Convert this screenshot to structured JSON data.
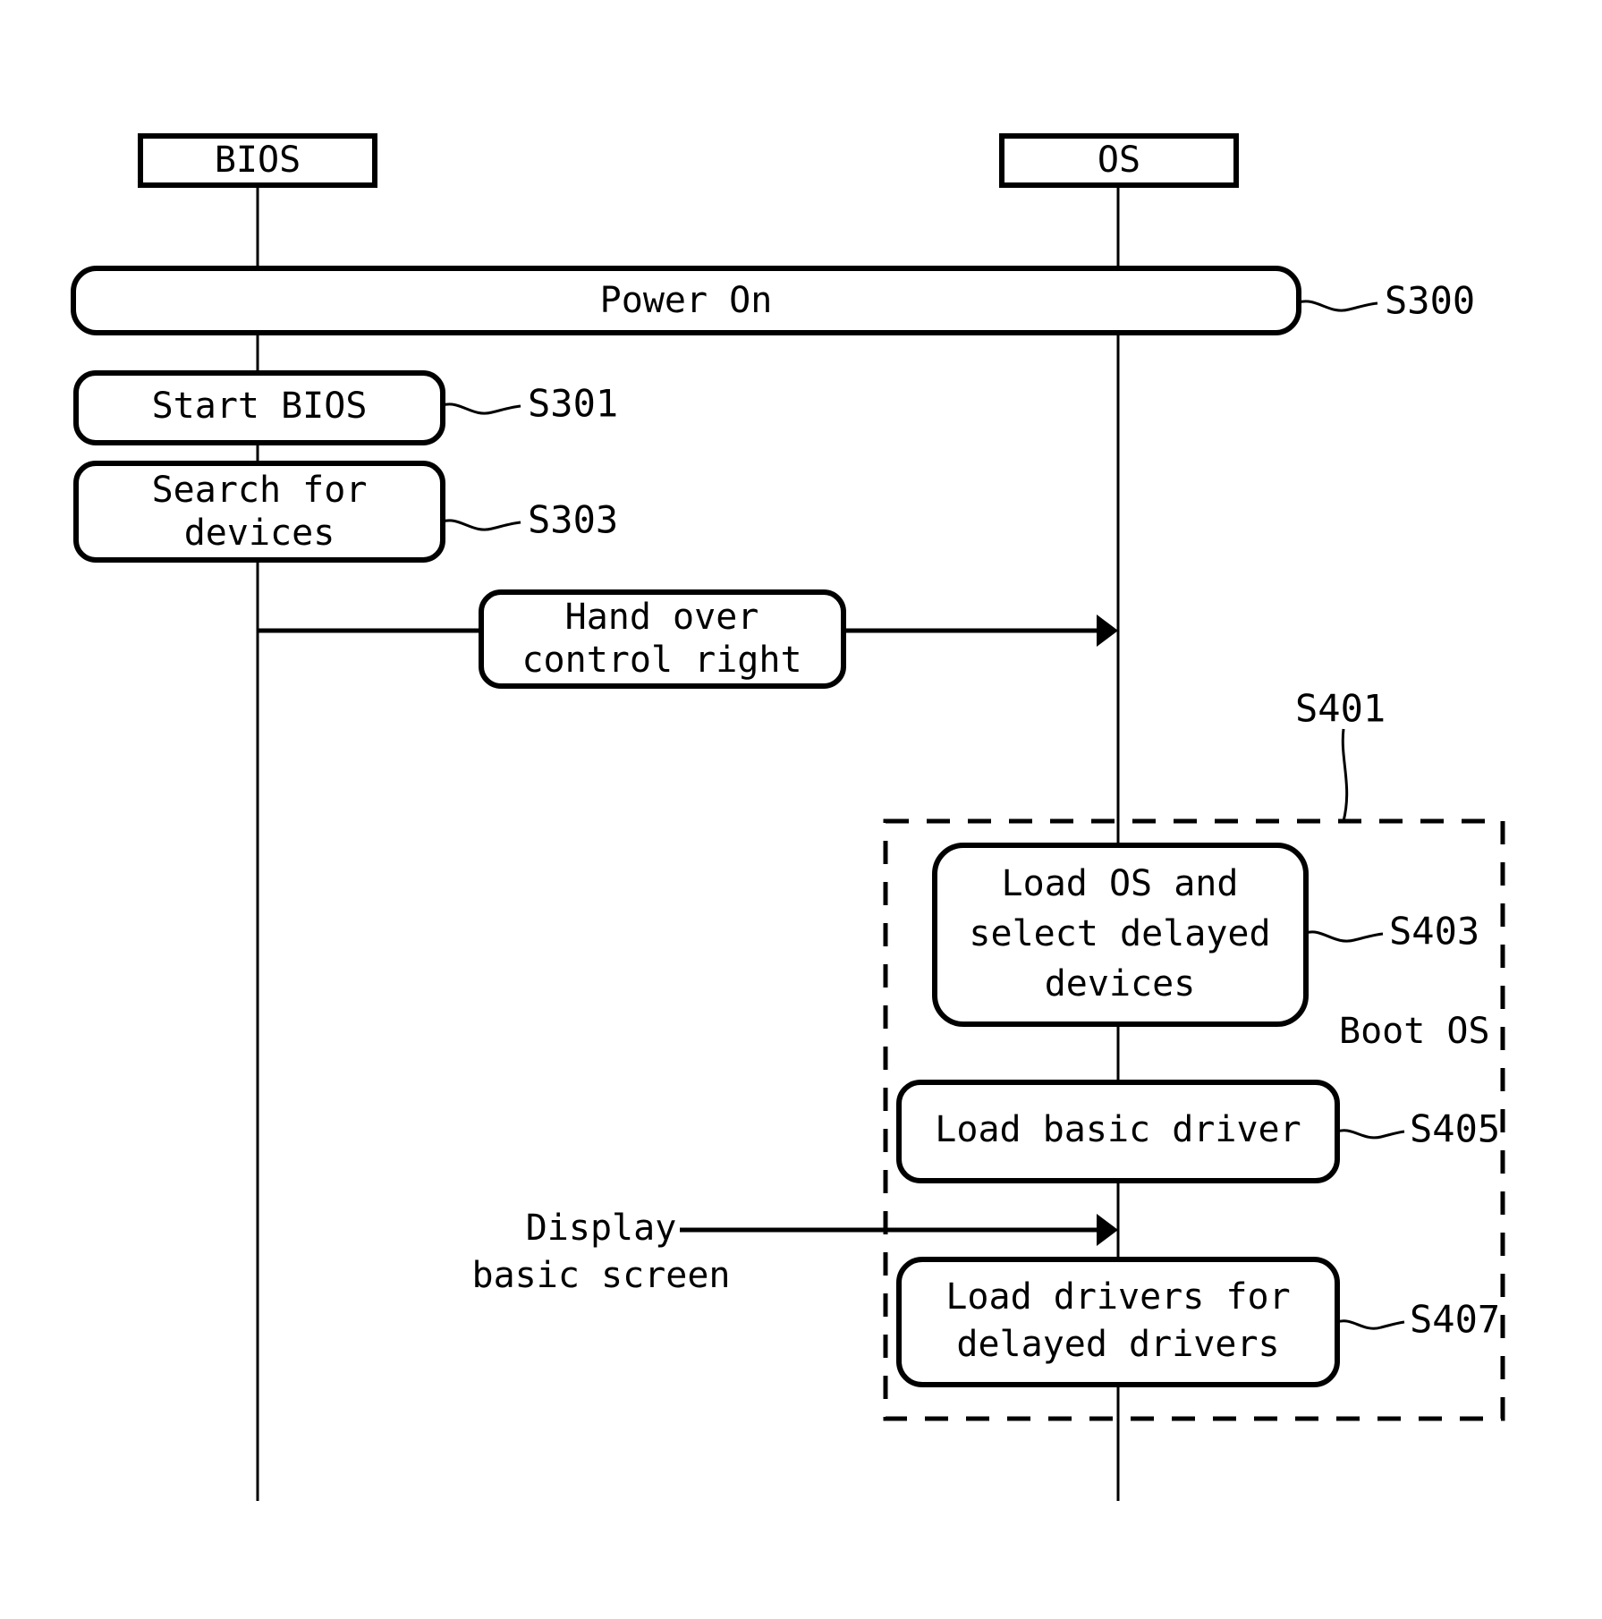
{
  "figure": {
    "type": "sequence-flow-diagram",
    "lifelines": [
      {
        "id": "bios",
        "label": "BIOS"
      },
      {
        "id": "os",
        "label": "OS"
      }
    ],
    "steps": [
      {
        "ref": "S300",
        "label": "Power On",
        "lane": "both"
      },
      {
        "ref": "S301",
        "label": "Start BIOS",
        "lane": "bios"
      },
      {
        "ref": "S303",
        "label_line1": "Search for",
        "label_line2": "devices",
        "lane": "bios"
      },
      {
        "ref": "",
        "label_line1": "Hand over",
        "label_line2": "control right",
        "lane": "bios-to-os"
      },
      {
        "ref": "S403",
        "label_line1": "Load OS and",
        "label_line2": "select delayed",
        "label_line3": "devices",
        "lane": "os"
      },
      {
        "ref": "S405",
        "label": "Load basic driver",
        "lane": "os"
      },
      {
        "ref": "S407",
        "label_line1": "Load drivers for",
        "label_line2": "delayed drivers",
        "lane": "os"
      }
    ],
    "group": {
      "ref": "S401",
      "label": "Boot OS"
    },
    "notes": [
      {
        "id": "display-basic-screen",
        "line1": "Display",
        "line2": "basic screen"
      }
    ],
    "colors": {
      "stroke": "#000000",
      "fill": "#ffffff",
      "background": "#ffffff"
    }
  }
}
